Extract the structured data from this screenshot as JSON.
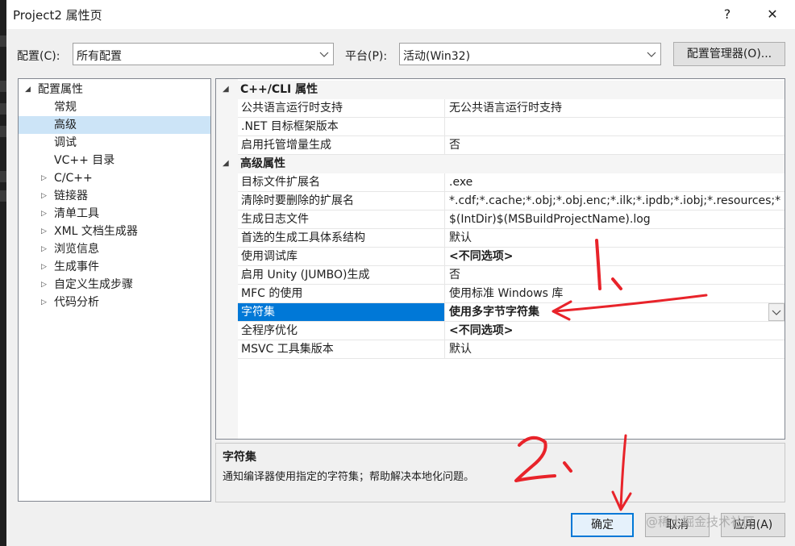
{
  "window": {
    "title": "Project2 属性页",
    "help_glyph": "?",
    "close_glyph": "✕"
  },
  "toolbar": {
    "config_label": "配置(C):",
    "config_value": "所有配置",
    "platform_label": "平台(P):",
    "platform_value": "活动(Win32)",
    "config_manager_label": "配置管理器(O)..."
  },
  "tree": {
    "root": "配置属性",
    "items": [
      {
        "label": "常规",
        "expandable": false,
        "selected": false
      },
      {
        "label": "高级",
        "expandable": false,
        "selected": true
      },
      {
        "label": "调试",
        "expandable": false,
        "selected": false
      },
      {
        "label": "VC++ 目录",
        "expandable": false,
        "selected": false
      },
      {
        "label": "C/C++",
        "expandable": true,
        "selected": false
      },
      {
        "label": "链接器",
        "expandable": true,
        "selected": false
      },
      {
        "label": "清单工具",
        "expandable": true,
        "selected": false
      },
      {
        "label": "XML 文档生成器",
        "expandable": true,
        "selected": false
      },
      {
        "label": "浏览信息",
        "expandable": true,
        "selected": false
      },
      {
        "label": "生成事件",
        "expandable": true,
        "selected": false
      },
      {
        "label": "自定义生成步骤",
        "expandable": true,
        "selected": false
      },
      {
        "label": "代码分析",
        "expandable": true,
        "selected": false
      }
    ]
  },
  "grid": {
    "categories": [
      {
        "title": "C++/CLI 属性",
        "rows": [
          {
            "name": "公共语言运行时支持",
            "value": "无公共语言运行时支持"
          },
          {
            "name": ".NET 目标框架版本",
            "value": ""
          },
          {
            "name": "启用托管增量生成",
            "value": "否"
          }
        ]
      },
      {
        "title": "高级属性",
        "rows": [
          {
            "name": "目标文件扩展名",
            "value": ".exe"
          },
          {
            "name": "清除时要删除的扩展名",
            "value": "*.cdf;*.cache;*.obj;*.obj.enc;*.ilk;*.ipdb;*.iobj;*.resources;*"
          },
          {
            "name": "生成日志文件",
            "value": "$(IntDir)$(MSBuildProjectName).log"
          },
          {
            "name": "首选的生成工具体系结构",
            "value": "默认"
          },
          {
            "name": "使用调试库",
            "value": "<不同选项>",
            "bold": true
          },
          {
            "name": "启用 Unity (JUMBO)生成",
            "value": "否"
          },
          {
            "name": "MFC 的使用",
            "value": "使用标准 Windows 库"
          },
          {
            "name": "字符集",
            "value": "使用多字节字符集",
            "bold": true,
            "selected": true
          },
          {
            "name": "全程序优化",
            "value": "<不同选项>",
            "bold": true
          },
          {
            "name": "MSVC 工具集版本",
            "value": "默认"
          }
        ]
      }
    ]
  },
  "description": {
    "title": "字符集",
    "text": "通知编译器使用指定的字符集；帮助解决本地化问题。"
  },
  "footer": {
    "ok_label": "确定",
    "cancel_label": "取消",
    "apply_label": "应用(A)"
  },
  "watermark": "@稀土掘金技术社区",
  "annotation_color": "#e8232a"
}
